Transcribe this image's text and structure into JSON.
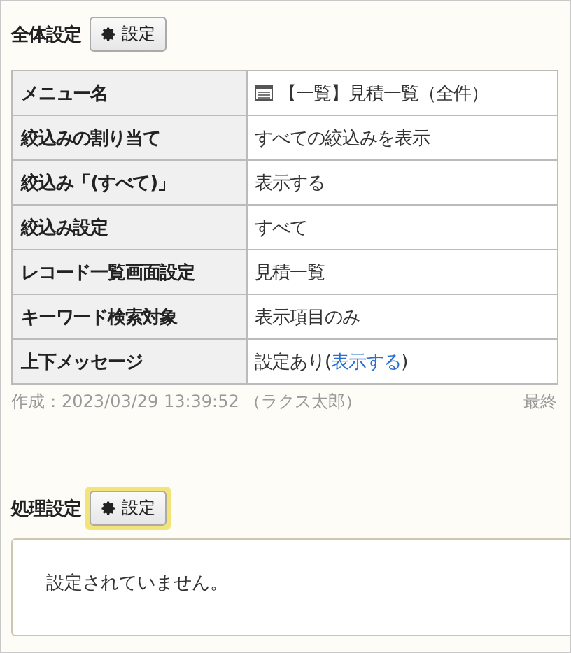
{
  "sections": [
    {
      "title": "全体設定",
      "button": {
        "label": "設定",
        "highlighted": false
      },
      "rows": [
        {
          "label": "メニュー名",
          "value": "【一覧】見積一覧（全件）",
          "kind": "menu"
        },
        {
          "label": "絞込みの割り当て",
          "value": "すべての絞込みを表示",
          "kind": "text"
        },
        {
          "label": "絞込み「(すべて)」",
          "value": "表示する",
          "kind": "text"
        },
        {
          "label": "絞込み設定",
          "value": "すべて",
          "kind": "text"
        },
        {
          "label": "レコード一覧画面設定",
          "value": "見積一覧",
          "kind": "text"
        },
        {
          "label": "キーワード検索対象",
          "value": "表示項目のみ",
          "kind": "text"
        },
        {
          "label": "上下メッセージ",
          "value": "設定あり(",
          "link": "表示する",
          "suffix": ")",
          "kind": "link"
        }
      ],
      "footer": [
        "作成：2023/03/29 13:39:52 （ラクス太郎）",
        "最終"
      ]
    },
    {
      "title": "処理設定",
      "button": {
        "label": "設定",
        "highlighted": true
      },
      "message": "設定されていません。"
    }
  ]
}
